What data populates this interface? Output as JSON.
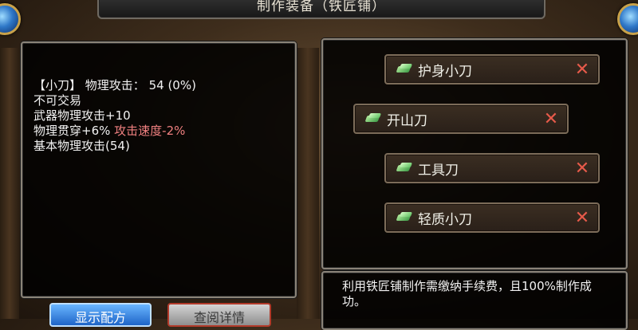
{
  "title": "制作装备（铁匠铺）",
  "item": {
    "line1_name": "【小刀】",
    "line1_stat": "物理攻击：",
    "line1_value": "54 (0%)",
    "line2": "不可交易",
    "line3": "武器物理攻击+10",
    "line4_main": "物理贯穿+6%",
    "line4_penalty": "攻击速度-2%",
    "line5": "基本物理攻击(54)"
  },
  "recipes": [
    {
      "label": "护身小刀",
      "remove": "✕"
    },
    {
      "label": "开山刀",
      "remove": "✕"
    },
    {
      "label": "工具刀",
      "remove": "✕"
    },
    {
      "label": "轻质小刀",
      "remove": "✕"
    }
  ],
  "notice": "利用铁匠铺制作需缴纳手续费，且100%制作成功。",
  "buttons": {
    "show_recipe": "显示配方",
    "view_details": "查阅详情"
  },
  "colors": {
    "penalty": "#f08080",
    "remove_icon": "#e65a4a",
    "primary_button": "#1e64c8"
  }
}
